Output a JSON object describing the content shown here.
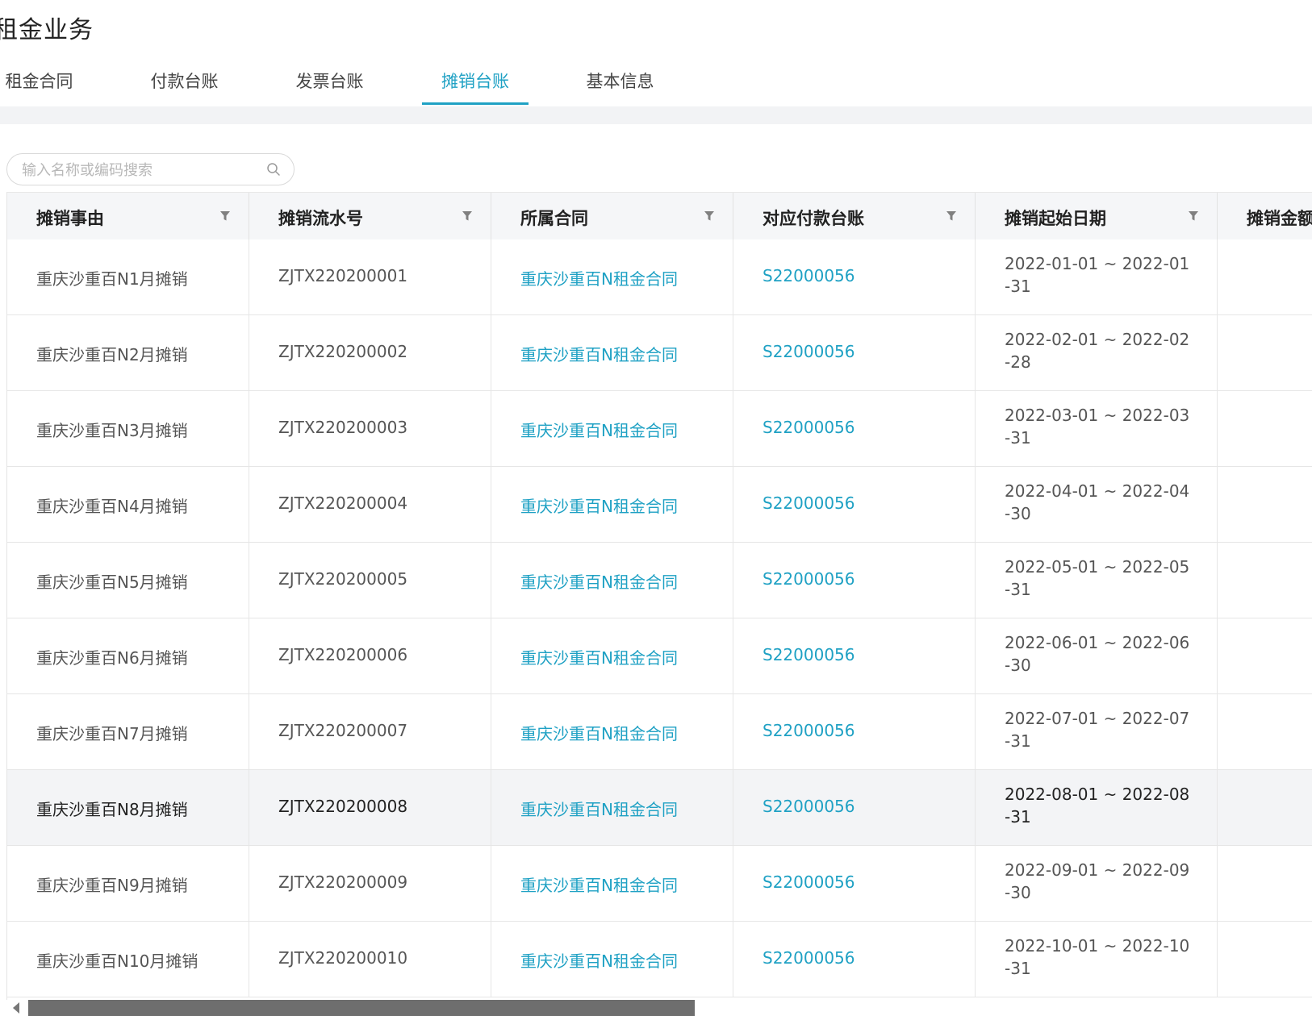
{
  "page": {
    "title": "租金业务"
  },
  "tabs": [
    {
      "label": "租金合同",
      "active": false
    },
    {
      "label": "付款台账",
      "active": false
    },
    {
      "label": "发票台账",
      "active": false
    },
    {
      "label": "摊销台账",
      "active": true
    },
    {
      "label": "基本信息",
      "active": false
    }
  ],
  "search": {
    "placeholder": "输入名称或编码搜索",
    "value": "",
    "icon": "search-icon"
  },
  "table": {
    "columns": [
      "摊销事由",
      "摊销流水号",
      "所属合同",
      "对应付款台账",
      "摊销起始日期",
      "摊销金额"
    ],
    "filter_icon": "filter-icon",
    "link_color": "#1fa1c4",
    "rows": [
      {
        "reason": "重庆沙重百N1月摊销",
        "serial": "ZJTX220200001",
        "contract": "重庆沙重百N租金合同",
        "payment": "S22000056",
        "date_range": "2022-01-01 ~ 2022-01-31",
        "amount": ""
      },
      {
        "reason": "重庆沙重百N2月摊销",
        "serial": "ZJTX220200002",
        "contract": "重庆沙重百N租金合同",
        "payment": "S22000056",
        "date_range": "2022-02-01 ~ 2022-02-28",
        "amount": ""
      },
      {
        "reason": "重庆沙重百N3月摊销",
        "serial": "ZJTX220200003",
        "contract": "重庆沙重百N租金合同",
        "payment": "S22000056",
        "date_range": "2022-03-01 ~ 2022-03-31",
        "amount": ""
      },
      {
        "reason": "重庆沙重百N4月摊销",
        "serial": "ZJTX220200004",
        "contract": "重庆沙重百N租金合同",
        "payment": "S22000056",
        "date_range": "2022-04-01 ~ 2022-04-30",
        "amount": ""
      },
      {
        "reason": "重庆沙重百N5月摊销",
        "serial": "ZJTX220200005",
        "contract": "重庆沙重百N租金合同",
        "payment": "S22000056",
        "date_range": "2022-05-01 ~ 2022-05-31",
        "amount": ""
      },
      {
        "reason": "重庆沙重百N6月摊销",
        "serial": "ZJTX220200006",
        "contract": "重庆沙重百N租金合同",
        "payment": "S22000056",
        "date_range": "2022-06-01 ~ 2022-06-30",
        "amount": ""
      },
      {
        "reason": "重庆沙重百N7月摊销",
        "serial": "ZJTX220200007",
        "contract": "重庆沙重百N租金合同",
        "payment": "S22000056",
        "date_range": "2022-07-01 ~ 2022-07-31",
        "amount": ""
      },
      {
        "reason": "重庆沙重百N8月摊销",
        "serial": "ZJTX220200008",
        "contract": "重庆沙重百N租金合同",
        "payment": "S22000056",
        "date_range": "2022-08-01 ~ 2022-08-31",
        "amount": "",
        "highlighted": true
      },
      {
        "reason": "重庆沙重百N9月摊销",
        "serial": "ZJTX220200009",
        "contract": "重庆沙重百N租金合同",
        "payment": "S22000056",
        "date_range": "2022-09-01 ~ 2022-09-30",
        "amount": ""
      },
      {
        "reason": "重庆沙重百N10月摊销",
        "serial": "ZJTX220200010",
        "contract": "重庆沙重百N租金合同",
        "payment": "S22000056",
        "date_range": "2022-10-01 ~ 2022-10-31",
        "amount": ""
      }
    ]
  }
}
